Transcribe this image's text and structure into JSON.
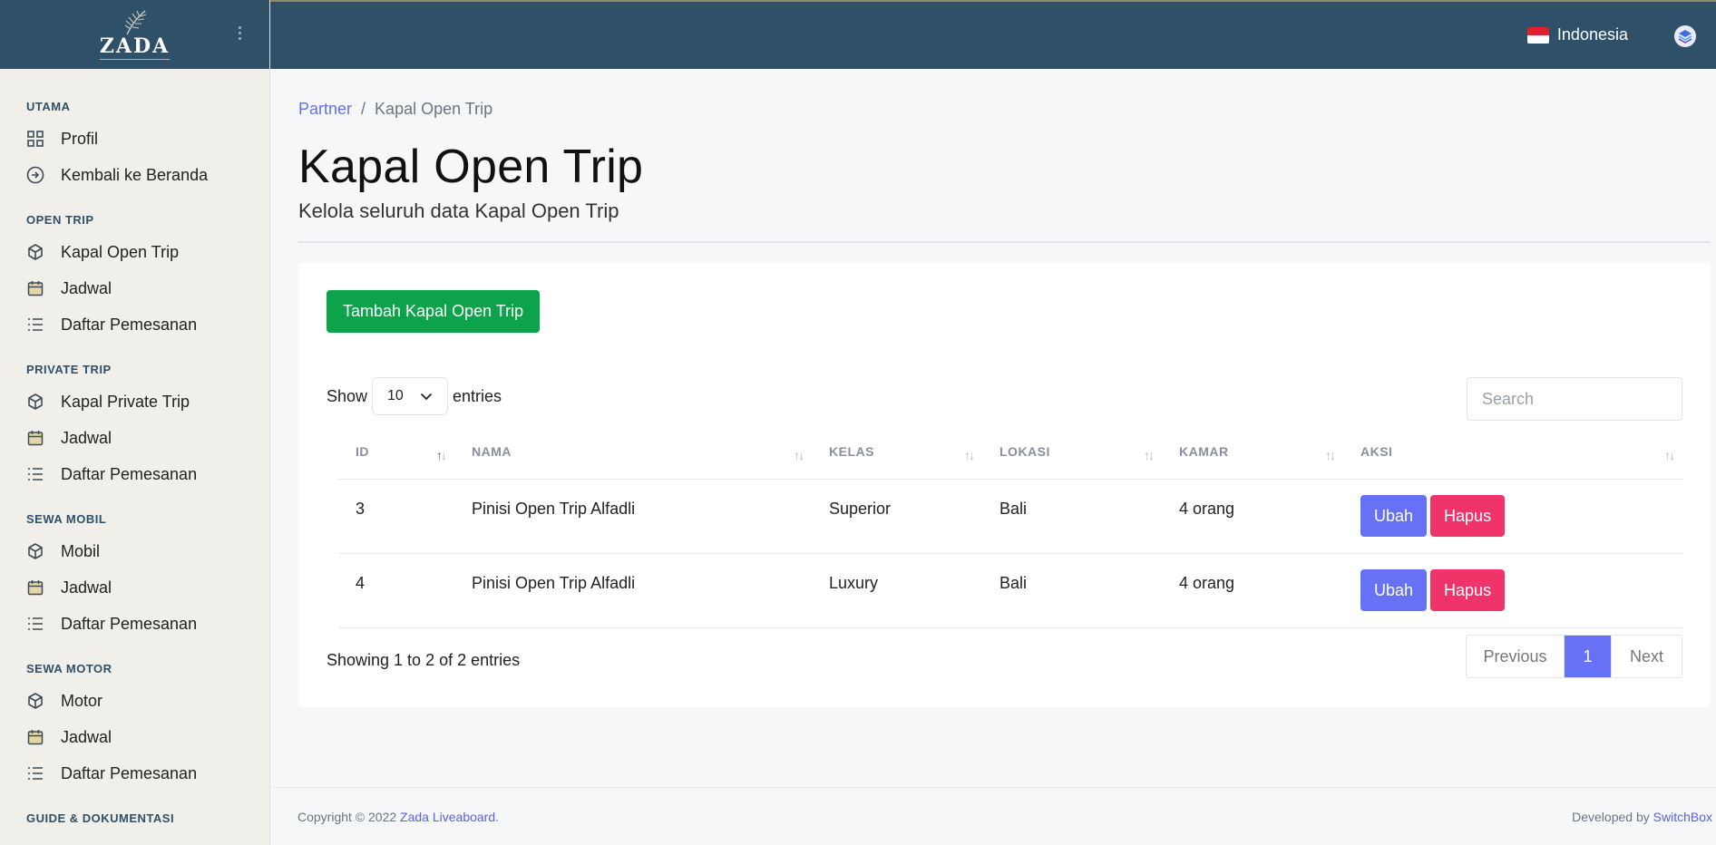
{
  "brand": {
    "name": "ZADA"
  },
  "topbar": {
    "language": "Indonesia"
  },
  "sidebar": {
    "sections": [
      {
        "heading": "UTAMA",
        "items": [
          {
            "label": "Profil",
            "icon": "grid-icon"
          },
          {
            "label": "Kembali ke Beranda",
            "icon": "arrow-circle-icon"
          }
        ]
      },
      {
        "heading": "OPEN TRIP",
        "items": [
          {
            "label": "Kapal Open Trip",
            "icon": "box-icon"
          },
          {
            "label": "Jadwal",
            "icon": "calendar-icon"
          },
          {
            "label": "Daftar Pemesanan",
            "icon": "list-icon"
          }
        ]
      },
      {
        "heading": "PRIVATE TRIP",
        "items": [
          {
            "label": "Kapal Private Trip",
            "icon": "box-icon"
          },
          {
            "label": "Jadwal",
            "icon": "calendar-icon"
          },
          {
            "label": "Daftar Pemesanan",
            "icon": "list-icon"
          }
        ]
      },
      {
        "heading": "SEWA MOBIL",
        "items": [
          {
            "label": "Mobil",
            "icon": "box-icon"
          },
          {
            "label": "Jadwal",
            "icon": "calendar-icon"
          },
          {
            "label": "Daftar Pemesanan",
            "icon": "list-icon"
          }
        ]
      },
      {
        "heading": "SEWA MOTOR",
        "items": [
          {
            "label": "Motor",
            "icon": "box-icon"
          },
          {
            "label": "Jadwal",
            "icon": "calendar-icon"
          },
          {
            "label": "Daftar Pemesanan",
            "icon": "list-icon"
          }
        ]
      },
      {
        "heading": "GUIDE & DOKUMENTASI",
        "items": []
      }
    ]
  },
  "breadcrumb": {
    "parent": "Partner",
    "separator": "/",
    "current": "Kapal Open Trip"
  },
  "page": {
    "title": "Kapal Open Trip",
    "subtitle": "Kelola seluruh data Kapal Open Trip"
  },
  "toolbar": {
    "add_label": "Tambah Kapal Open Trip"
  },
  "table_controls": {
    "show_label": "Show",
    "entries_value": "10",
    "entries_label": "entries",
    "search_placeholder": "Search"
  },
  "table": {
    "columns": [
      "ID",
      "NAMA",
      "KELAS",
      "LOKASI",
      "KAMAR",
      "AKSI"
    ],
    "rows": [
      {
        "id": "3",
        "nama": "Pinisi Open Trip Alfadli",
        "kelas": "Superior",
        "lokasi": "Bali",
        "kamar": "4 orang",
        "edit": "Ubah",
        "delete": "Hapus"
      },
      {
        "id": "4",
        "nama": "Pinisi Open Trip Alfadli",
        "kelas": "Luxury",
        "lokasi": "Bali",
        "kamar": "4 orang",
        "edit": "Ubah",
        "delete": "Hapus"
      }
    ]
  },
  "pagination": {
    "info": "Showing 1 to 2 of 2 entries",
    "previous": "Previous",
    "current": "1",
    "next": "Next"
  },
  "footer": {
    "copyright_prefix": "Copyright © 2022",
    "copyright_link": "Zada Liveaboard",
    "copyright_suffix": ".",
    "developed_prefix": "Developed by",
    "developed_link": "SwitchBox"
  },
  "colors": {
    "header": "#2f5069",
    "sidebar": "#f0efe9",
    "accent": "#6771f5",
    "success": "#0da34a",
    "danger": "#f0346a"
  }
}
